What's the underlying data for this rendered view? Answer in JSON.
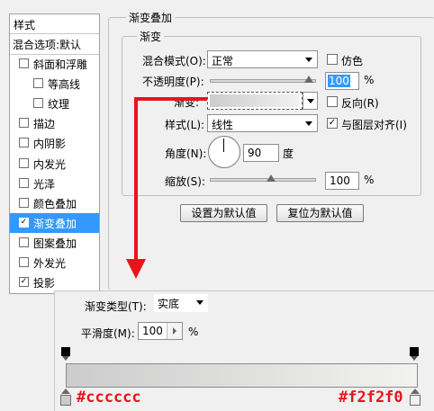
{
  "stylelist": {
    "header": "样式",
    "blend_defaults": "混合选项:默认",
    "items": [
      {
        "label": "斜面和浮雕",
        "checked": false,
        "indent": false
      },
      {
        "label": "等高线",
        "checked": false,
        "indent": true
      },
      {
        "label": "纹理",
        "checked": false,
        "indent": true
      },
      {
        "label": "描边",
        "checked": false,
        "indent": false
      },
      {
        "label": "内阴影",
        "checked": false,
        "indent": false
      },
      {
        "label": "内发光",
        "checked": false,
        "indent": false
      },
      {
        "label": "光泽",
        "checked": false,
        "indent": false
      },
      {
        "label": "颜色叠加",
        "checked": false,
        "indent": false
      },
      {
        "label": "渐变叠加",
        "checked": true,
        "indent": false,
        "selected": true
      },
      {
        "label": "图案叠加",
        "checked": false,
        "indent": false
      },
      {
        "label": "外发光",
        "checked": false,
        "indent": false
      },
      {
        "label": "投影",
        "checked": true,
        "indent": false
      }
    ]
  },
  "panel": {
    "outer_title": "渐变叠加",
    "inner_title": "渐变",
    "blend_mode_label": "混合模式(O):",
    "blend_mode_value": "正常",
    "dither_label": "仿色",
    "opacity_label": "不透明度(P):",
    "opacity_value": "100",
    "percent": "%",
    "gradient_label": "渐变:",
    "reverse_label": "反向(R)",
    "style_label": "样式(L):",
    "style_value": "线性",
    "align_label": "与图层对齐(I)",
    "angle_label": "角度(N):",
    "angle_value": "90",
    "angle_unit": "度",
    "scale_label": "缩放(S):",
    "scale_value": "100",
    "set_default_btn": "设置为默认值",
    "reset_default_btn": "复位为默认值"
  },
  "editor": {
    "type_label": "渐变类型(T):",
    "type_value": "实底",
    "smooth_label": "平滑度(M):",
    "smooth_value": "100",
    "smooth_unit": "%",
    "color_left": "#cccccc",
    "color_right": "#f2f2f0",
    "annot_left": "#cccccc",
    "annot_right": "#f2f2f0"
  },
  "colors": {
    "annotation_red": "#e8141b",
    "selection_blue": "#3399ff"
  }
}
